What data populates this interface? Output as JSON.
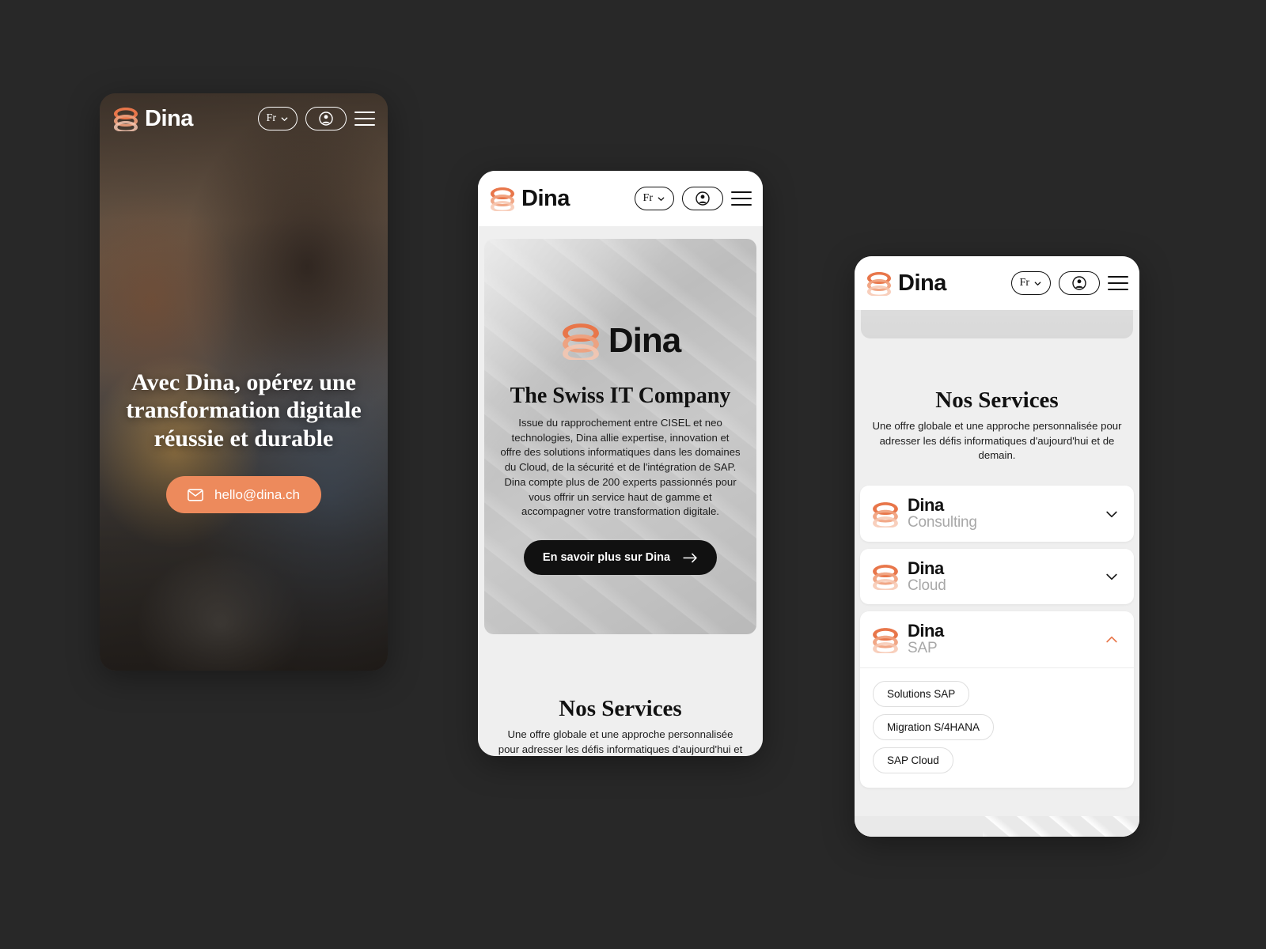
{
  "background_color": "#282828",
  "brand": {
    "name": "Dina",
    "accent_color": "#ED8A5C"
  },
  "nav": {
    "lang_label": "Fr",
    "lang_icon": "chevron-down-icon",
    "account_icon": "account-circle-icon",
    "menu_icon": "hamburger-menu-icon"
  },
  "phone1": {
    "headline": "Avec Dina, opérez une transformation digitale réussie et durable",
    "cta": {
      "label": "hello@dina.ch",
      "icon": "mail-icon",
      "bg_color": "#ED8A5C"
    }
  },
  "phone2": {
    "hero_logo_word": "Dina",
    "title": "The Swiss IT Company",
    "body": "Issue du rapprochement entre CISEL et neo technologies, Dina allie expertise, innovation et offre des solutions informatiques dans les domaines du Cloud, de la sécurité et de l'intégration de SAP. Dina compte plus de 200 experts passionnés pour vous offrir un service haut de gamme et accompagner votre transformation digitale.",
    "cta": {
      "label": "En savoir plus sur Dina",
      "icon": "arrow-right-icon"
    },
    "services": {
      "title": "Nos Services",
      "subtitle": "Une offre globale et une approche personnalisée pour adresser les défis informatiques d'aujourd'hui et de demain."
    }
  },
  "phone3": {
    "services": {
      "title": "Nos Services",
      "subtitle": "Une offre globale et une approche personnalisée pour adresser les défis informatiques d'aujourd'hui et de demain."
    },
    "accordion": [
      {
        "main": "Dina",
        "sub": "Consulting",
        "expanded": false,
        "chevron": "chevron-down-icon",
        "tags": []
      },
      {
        "main": "Dina",
        "sub": "Cloud",
        "expanded": false,
        "chevron": "chevron-down-icon",
        "tags": []
      },
      {
        "main": "Dina",
        "sub": "SAP",
        "expanded": true,
        "chevron": "chevron-up-icon",
        "tags": [
          "Solutions SAP",
          "Migration S/4HANA",
          "SAP Cloud"
        ]
      }
    ]
  }
}
